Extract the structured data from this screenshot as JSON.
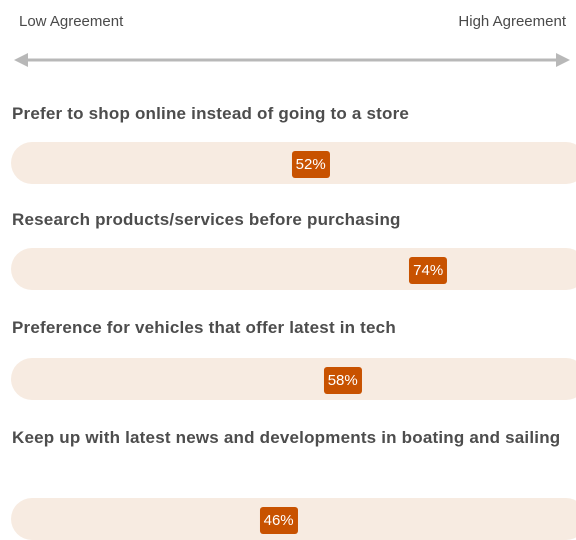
{
  "scale": {
    "low_label": "Low Agreement",
    "high_label": "High Agreement"
  },
  "colors": {
    "track": "#f7ebe1",
    "marker": "#c85200",
    "arrow": "#b8b8b8",
    "label": "#4d4d4d"
  },
  "chart_data": {
    "type": "bar",
    "unit": "%",
    "xlim": [
      0,
      100
    ],
    "categories": [
      "Prefer to shop online instead of going to a store",
      "Research products/services before purchasing",
      "Preference for vehicles that offer latest in tech",
      "Keep up with latest news and developments in boating and sailing"
    ],
    "values": [
      52,
      74,
      58,
      46
    ],
    "value_labels": [
      "52%",
      "74%",
      "58%",
      "46%"
    ]
  }
}
